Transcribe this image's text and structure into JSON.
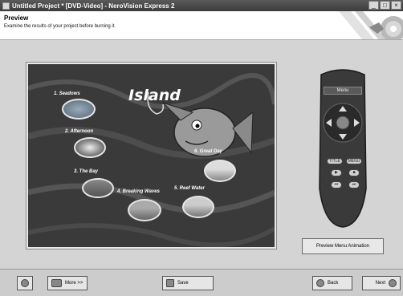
{
  "window": {
    "title": "Untitled Project * [DVD-Video] - NeroVision Express 2"
  },
  "header": {
    "title": "Preview",
    "subtitle": "Examine the results of your project before burning it."
  },
  "menu_preview": {
    "title": "Island",
    "items": [
      {
        "label": "1. Seadows"
      },
      {
        "label": "2. Afternoon"
      },
      {
        "label": "3. The Bay"
      },
      {
        "label": "4. Breaking Waves"
      },
      {
        "label": "5. Reef Water"
      },
      {
        "label": "6. Great Day"
      }
    ]
  },
  "remote": {
    "screen_label": "Menu",
    "title_btn": "TITLE",
    "menu_btn": "MENU"
  },
  "preview_button": {
    "label": "Preview Menu Animation"
  },
  "footer": {
    "more_label": "More >>",
    "save_label": "Save",
    "back_label": "Back",
    "next_label": "Next"
  },
  "colors": {
    "title_bar": "#3c3c3c",
    "background": "#d4d4d4"
  }
}
